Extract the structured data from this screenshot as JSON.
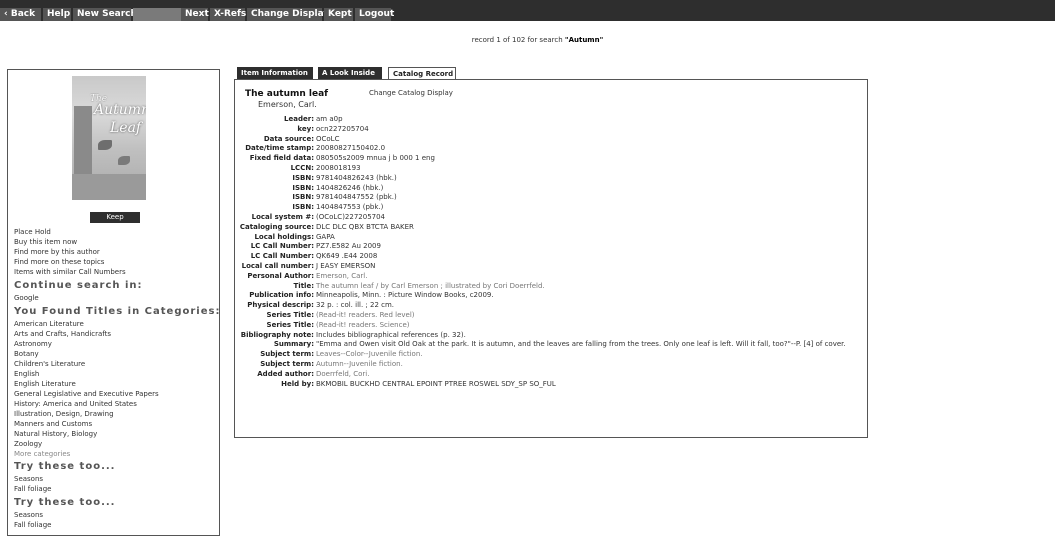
{
  "toolbar": {
    "back": "Back",
    "help": "Help",
    "new_search": "New Search",
    "next": "Next",
    "xrefs": "X-Refs",
    "change_display": "Change Display",
    "kept": "Kept",
    "logout": "Logout"
  },
  "record_line": {
    "prefix": "record 1 of 102 for search",
    "term": "\"Autumn\""
  },
  "sidebar": {
    "cover": {
      "line1": "The",
      "line2": "Autumn",
      "line3": "Leaf"
    },
    "keep": "Keep",
    "links": [
      "Place Hold",
      "Buy this item now",
      "Find more by this author",
      "Find more on these topics",
      "Items with similar Call Numbers"
    ],
    "continue_heading": "Continue search in:",
    "continue_items": [
      "Google"
    ],
    "categories_heading": "You Found Titles in Categories:",
    "categories": [
      "American Literature",
      "Arts and Crafts, Handicrafts",
      "Astronomy",
      "Botany",
      "Children's Literature",
      "English",
      "English Literature",
      "General Legislative and Executive Papers",
      "History: America and United States",
      "Illustration, Design, Drawing",
      "Manners and Customs",
      "Natural History, Biology",
      "Zoology"
    ],
    "more_categories": "More categories",
    "try1_heading": "Try these too...",
    "try1": [
      "Seasons",
      "Fall foliage"
    ],
    "try2_heading": "Try these too...",
    "try2": [
      "Seasons",
      "Fall foliage"
    ]
  },
  "tabs": [
    "Item Information",
    "A Look Inside",
    "Catalog Record"
  ],
  "record": {
    "title": "The autumn leaf",
    "author": "Emerson, Carl.",
    "change_display": "Change Catalog Display",
    "fields": [
      {
        "label": "Leader:",
        "value": "am a0p"
      },
      {
        "label": "key:",
        "value": "ocn227205704"
      },
      {
        "label": "Data source:",
        "value": "OCoLC"
      },
      {
        "label": "Date/time stamp:",
        "value": "20080827150402.0"
      },
      {
        "label": "Fixed field data:",
        "value": "080505s2009 mnua j b 000 1 eng"
      },
      {
        "label": "LCCN:",
        "value": "2008018193"
      },
      {
        "label": "ISBN:",
        "value": "9781404826243 (hbk.)"
      },
      {
        "label": "ISBN:",
        "value": "1404826246 (hbk.)"
      },
      {
        "label": "ISBN:",
        "value": "9781404847552 (pbk.)"
      },
      {
        "label": "ISBN:",
        "value": "1404847553 (pbk.)"
      },
      {
        "label": "Local system #:",
        "value": "(OCoLC)227205704"
      },
      {
        "label": "Cataloging source:",
        "value": "DLC DLC QBX BTCTA BAKER"
      },
      {
        "label": "Local holdings:",
        "value": "GAPA"
      },
      {
        "label": "LC Call Number:",
        "value": "PZ7.E582 Au 2009"
      },
      {
        "label": "LC Call Number:",
        "value": "QK649 .E44 2008"
      },
      {
        "label": "Local call number:",
        "value": "J EASY EMERSON"
      },
      {
        "label": "Personal Author:",
        "value": "Emerson, Carl."
      },
      {
        "label": "Title:",
        "value": "The autumn leaf / by Carl Emerson ; illustrated by Cori Doerrfeld."
      },
      {
        "label": "Publication info:",
        "value": "Minneapolis, Minn. : Picture Window Books, c2009."
      },
      {
        "label": "Physical descrip:",
        "value": "32 p. : col. ill. ; 22 cm."
      },
      {
        "label": "Series Title:",
        "value": "(Read-it! readers. Red level)"
      },
      {
        "label": "Series Title:",
        "value": "(Read-it! readers. Science)"
      },
      {
        "label": "Bibliography note:",
        "value": "Includes bibliographical references (p. 32)."
      },
      {
        "label": "Summary:",
        "value": "\"Emma and Owen visit Old Oak at the park. It is autumn, and the leaves are falling from the trees. Only one leaf is left. Will it fall, too?\"--P. [4] of cover."
      },
      {
        "label": "Subject term:",
        "value": "Leaves--Color--Juvenile fiction."
      },
      {
        "label": "Subject term:",
        "value": "Autumn--Juvenile fiction."
      },
      {
        "label": "Added author:",
        "value": "Doerrfeld, Cori."
      },
      {
        "label": "Held by:",
        "value": "BKMOBIL BUCKHD CENTRAL EPOINT PTREE ROSWEL SDY_SP SO_FUL"
      }
    ]
  }
}
